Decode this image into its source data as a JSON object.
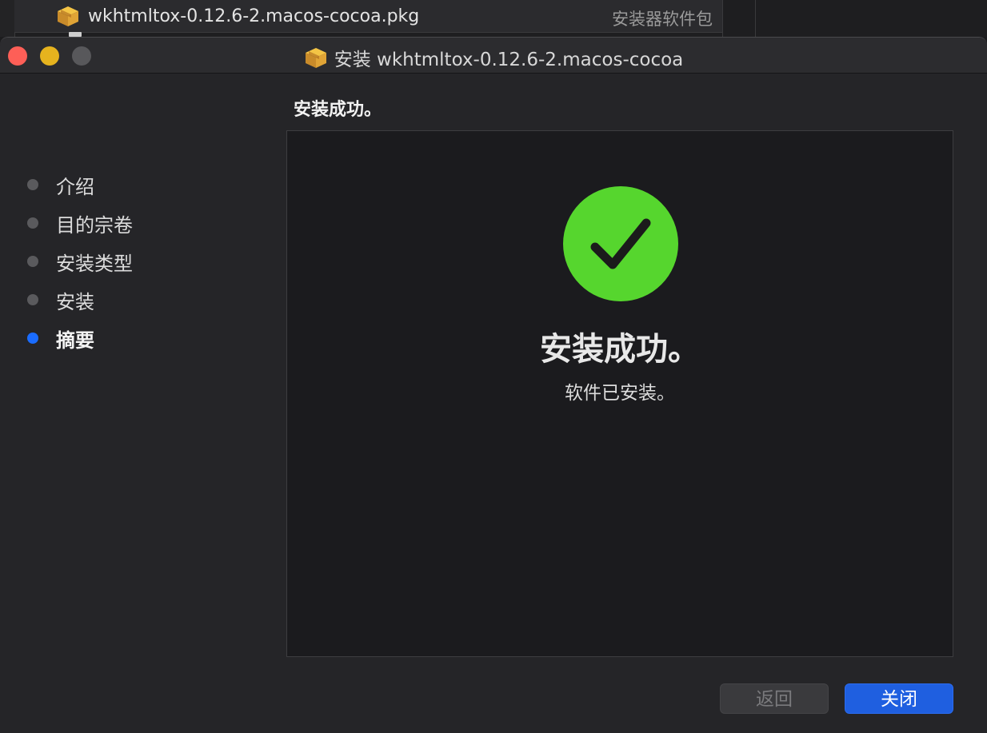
{
  "finder": {
    "file_name": "wkhtmltox-0.12.6-2.macos-cocoa.pkg",
    "file_kind": "安装器软件包"
  },
  "window": {
    "title": "安装 wkhtmltox-0.12.6-2.macos-cocoa"
  },
  "header": {
    "section_title": "安装成功。"
  },
  "sidebar": {
    "steps": [
      {
        "label": "介绍",
        "state": "done"
      },
      {
        "label": "目的宗卷",
        "state": "done"
      },
      {
        "label": "安装类型",
        "state": "done"
      },
      {
        "label": "安装",
        "state": "done"
      },
      {
        "label": "摘要",
        "state": "active"
      }
    ]
  },
  "main": {
    "status_icon": "checkmark-circle-icon",
    "success_title": "安装成功。",
    "success_message": "软件已安装。"
  },
  "buttons": {
    "back_label": "返回",
    "close_label": "关闭"
  },
  "colors": {
    "success_green": "#56d62e",
    "active_step_blue": "#1a6cff",
    "primary_button": "#1f5fe0",
    "traffic_close": "#fe5f57",
    "traffic_minimize": "#e6b31e"
  }
}
